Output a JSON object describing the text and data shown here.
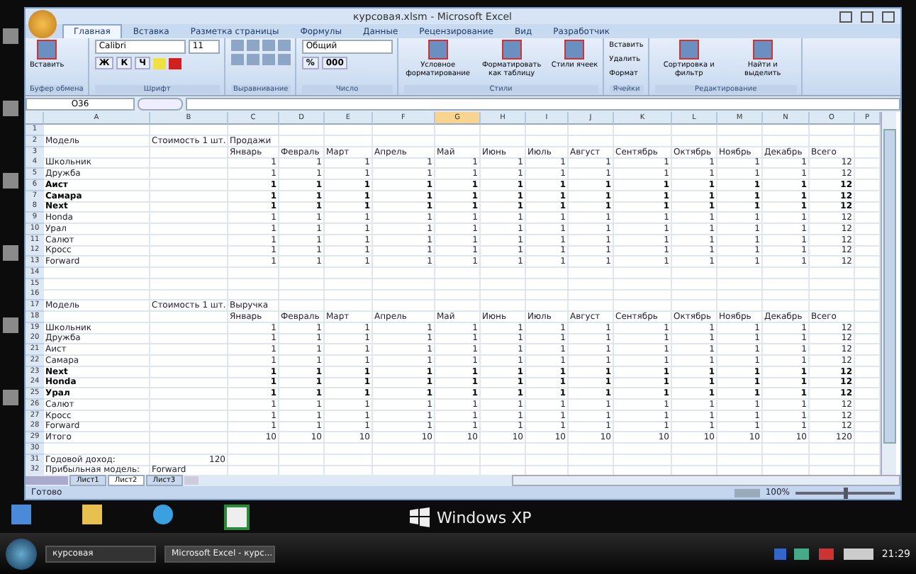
{
  "window": {
    "title": "курсовая.xlsm - Microsoft Excel"
  },
  "tabs": [
    {
      "label": "Главная",
      "selected": true
    },
    {
      "label": "Вставка",
      "selected": false
    },
    {
      "label": "Разметка страницы",
      "selected": false
    },
    {
      "label": "Формулы",
      "selected": false
    },
    {
      "label": "Данные",
      "selected": false
    },
    {
      "label": "Рецензирование",
      "selected": false
    },
    {
      "label": "Вид",
      "selected": false
    },
    {
      "label": "Разработчик",
      "selected": false
    }
  ],
  "ribbon": {
    "font_name": "Calibri",
    "font_size": "11",
    "number_format": "Общий",
    "groups": [
      {
        "label": "Буфер обмена",
        "buttons": [
          "Вставить"
        ]
      },
      {
        "label": "Шрифт",
        "buttons": [
          "Ж",
          "К",
          "Ч"
        ]
      },
      {
        "label": "Выравнивание"
      },
      {
        "label": "Число",
        "buttons": [
          "%",
          "000"
        ]
      },
      {
        "label": "Стили",
        "buttons": [
          "Условное форматирование",
          "Форматировать как таблицу",
          "Стили ячеек"
        ]
      },
      {
        "label": "Ячейки",
        "buttons": [
          "Вставить",
          "Удалить",
          "Формат"
        ]
      },
      {
        "label": "Редактирование",
        "buttons": [
          "Сортировка и фильтр",
          "Найти и выделить"
        ]
      }
    ]
  },
  "formula_bar": {
    "name_box": "O36"
  },
  "sheet": {
    "columns": [
      {
        "label": "A",
        "selected": false
      },
      {
        "label": "B",
        "selected": false
      },
      {
        "label": "C",
        "selected": false
      },
      {
        "label": "D",
        "selected": false
      },
      {
        "label": "E",
        "selected": false
      },
      {
        "label": "F",
        "selected": false
      },
      {
        "label": "G",
        "selected": true
      },
      {
        "label": "H",
        "selected": false
      },
      {
        "label": "I",
        "selected": false
      },
      {
        "label": "J",
        "selected": false
      },
      {
        "label": "K",
        "selected": false
      },
      {
        "label": "L",
        "selected": false
      },
      {
        "label": "M",
        "selected": false
      },
      {
        "label": "N",
        "selected": false
      },
      {
        "label": "O",
        "selected": false
      },
      {
        "label": "P",
        "selected": false
      }
    ],
    "rows": [
      {
        "n": "1",
        "kind": "label",
        "cells": []
      },
      {
        "n": "2",
        "kind": "label",
        "bold": false,
        "cells": [
          "Модель",
          "Стоимость 1 шт.",
          "Продажи"
        ]
      },
      {
        "n": "3",
        "kind": "label",
        "bold": false,
        "cells": [
          "",
          "",
          "Январь",
          "Февраль",
          "Март",
          "Апрель",
          "Май",
          "Июнь",
          "Июль",
          "Август",
          "Сентябрь",
          "Октябрь",
          "Ноябрь",
          "Декабрь",
          "Всего"
        ]
      },
      {
        "n": "4",
        "kind": "data",
        "bold": false,
        "cells": [
          "Школьник",
          "",
          "1",
          "1",
          "1",
          "1",
          "1",
          "1",
          "1",
          "1",
          "1",
          "1",
          "1",
          "1",
          "12"
        ]
      },
      {
        "n": "5",
        "kind": "data",
        "bold": false,
        "cells": [
          "Дружба",
          "",
          "1",
          "1",
          "1",
          "1",
          "1",
          "1",
          "1",
          "1",
          "1",
          "1",
          "1",
          "1",
          "12"
        ]
      },
      {
        "n": "6",
        "kind": "data",
        "bold": true,
        "cells": [
          "Аист",
          "",
          "1",
          "1",
          "1",
          "1",
          "1",
          "1",
          "1",
          "1",
          "1",
          "1",
          "1",
          "1",
          "12"
        ]
      },
      {
        "n": "7",
        "kind": "data",
        "bold": true,
        "cells": [
          "Самара",
          "",
          "1",
          "1",
          "1",
          "1",
          "1",
          "1",
          "1",
          "1",
          "1",
          "1",
          "1",
          "1",
          "12"
        ]
      },
      {
        "n": "8",
        "kind": "data",
        "bold": true,
        "cells": [
          "Next",
          "",
          "1",
          "1",
          "1",
          "1",
          "1",
          "1",
          "1",
          "1",
          "1",
          "1",
          "1",
          "1",
          "12"
        ]
      },
      {
        "n": "9",
        "kind": "data",
        "bold": false,
        "cells": [
          "Honda",
          "",
          "1",
          "1",
          "1",
          "1",
          "1",
          "1",
          "1",
          "1",
          "1",
          "1",
          "1",
          "1",
          "12"
        ]
      },
      {
        "n": "10",
        "kind": "data",
        "bold": false,
        "cells": [
          "Урал",
          "",
          "1",
          "1",
          "1",
          "1",
          "1",
          "1",
          "1",
          "1",
          "1",
          "1",
          "1",
          "1",
          "12"
        ]
      },
      {
        "n": "11",
        "kind": "data",
        "bold": false,
        "cells": [
          "Салют",
          "",
          "1",
          "1",
          "1",
          "1",
          "1",
          "1",
          "1",
          "1",
          "1",
          "1",
          "1",
          "1",
          "12"
        ]
      },
      {
        "n": "12",
        "kind": "data",
        "bold": false,
        "cells": [
          "Кросс",
          "",
          "1",
          "1",
          "1",
          "1",
          "1",
          "1",
          "1",
          "1",
          "1",
          "1",
          "1",
          "1",
          "12"
        ]
      },
      {
        "n": "13",
        "kind": "data",
        "bold": false,
        "cells": [
          "Forward",
          "",
          "1",
          "1",
          "1",
          "1",
          "1",
          "1",
          "1",
          "1",
          "1",
          "1",
          "1",
          "1",
          "12"
        ]
      },
      {
        "n": "14",
        "kind": "label",
        "cells": []
      },
      {
        "n": "15",
        "kind": "label",
        "cells": []
      },
      {
        "n": "16",
        "kind": "label",
        "cells": []
      },
      {
        "n": "17",
        "kind": "label",
        "bold": false,
        "cells": [
          "Модель",
          "Стоимость 1 шт.",
          "Выручка"
        ]
      },
      {
        "n": "18",
        "kind": "label",
        "bold": false,
        "cells": [
          "",
          "",
          "Январь",
          "Февраль",
          "Март",
          "Апрель",
          "Май",
          "Июнь",
          "Июль",
          "Август",
          "Сентябрь",
          "Октябрь",
          "Ноябрь",
          "Декабрь",
          "Всего"
        ]
      },
      {
        "n": "19",
        "kind": "data",
        "bold": false,
        "cells": [
          "Школьник",
          "",
          "1",
          "1",
          "1",
          "1",
          "1",
          "1",
          "1",
          "1",
          "1",
          "1",
          "1",
          "1",
          "12"
        ]
      },
      {
        "n": "20",
        "kind": "data",
        "bold": false,
        "cells": [
          "Дружба",
          "",
          "1",
          "1",
          "1",
          "1",
          "1",
          "1",
          "1",
          "1",
          "1",
          "1",
          "1",
          "1",
          "12"
        ]
      },
      {
        "n": "21",
        "kind": "data",
        "bold": false,
        "cells": [
          "Аист",
          "",
          "1",
          "1",
          "1",
          "1",
          "1",
          "1",
          "1",
          "1",
          "1",
          "1",
          "1",
          "1",
          "12"
        ]
      },
      {
        "n": "22",
        "kind": "data",
        "bold": false,
        "cells": [
          "Самара",
          "",
          "1",
          "1",
          "1",
          "1",
          "1",
          "1",
          "1",
          "1",
          "1",
          "1",
          "1",
          "1",
          "12"
        ]
      },
      {
        "n": "23",
        "kind": "data",
        "bold": true,
        "cells": [
          "Next",
          "",
          "1",
          "1",
          "1",
          "1",
          "1",
          "1",
          "1",
          "1",
          "1",
          "1",
          "1",
          "1",
          "12"
        ]
      },
      {
        "n": "24",
        "kind": "data",
        "bold": true,
        "cells": [
          "Honda",
          "",
          "1",
          "1",
          "1",
          "1",
          "1",
          "1",
          "1",
          "1",
          "1",
          "1",
          "1",
          "1",
          "12"
        ]
      },
      {
        "n": "25",
        "kind": "data",
        "bold": true,
        "cells": [
          "Урал",
          "",
          "1",
          "1",
          "1",
          "1",
          "1",
          "1",
          "1",
          "1",
          "1",
          "1",
          "1",
          "1",
          "12"
        ]
      },
      {
        "n": "26",
        "kind": "data",
        "bold": false,
        "cells": [
          "Салют",
          "",
          "1",
          "1",
          "1",
          "1",
          "1",
          "1",
          "1",
          "1",
          "1",
          "1",
          "1",
          "1",
          "12"
        ]
      },
      {
        "n": "27",
        "kind": "data",
        "bold": false,
        "cells": [
          "Кросс",
          "",
          "1",
          "1",
          "1",
          "1",
          "1",
          "1",
          "1",
          "1",
          "1",
          "1",
          "1",
          "1",
          "12"
        ]
      },
      {
        "n": "28",
        "kind": "data",
        "bold": false,
        "cells": [
          "Forward",
          "",
          "1",
          "1",
          "1",
          "1",
          "1",
          "1",
          "1",
          "1",
          "1",
          "1",
          "1",
          "1",
          "12"
        ]
      },
      {
        "n": "29",
        "kind": "data",
        "bold": false,
        "cells": [
          "Итого",
          "",
          "10",
          "10",
          "10",
          "10",
          "10",
          "10",
          "10",
          "10",
          "10",
          "10",
          "10",
          "10",
          "120"
        ]
      },
      {
        "n": "30",
        "kind": "label",
        "cells": []
      },
      {
        "n": "31",
        "kind": "data",
        "bold": false,
        "cells": [
          "Годовой доход:",
          "120"
        ]
      },
      {
        "n": "32",
        "kind": "label",
        "bold": false,
        "cells": [
          "Прибыльная модель:",
          "Forward"
        ]
      }
    ]
  },
  "sheet_tabs": [
    {
      "label": "Лист1",
      "selected": false
    },
    {
      "label": "Лист2",
      "selected": true
    },
    {
      "label": "Лист3",
      "selected": false
    }
  ],
  "status_bar": {
    "status": "Готово",
    "zoom": "100%",
    "zoom_slider": {
      "level": 0.5
    }
  },
  "desktop": {
    "logo_text": "Windows XP"
  },
  "taskbar": {
    "tasks": [
      {
        "label": "курсовая",
        "selected": false
      },
      {
        "label": "Microsoft Excel - курс...",
        "selected": true
      }
    ],
    "clock": "21:29"
  }
}
